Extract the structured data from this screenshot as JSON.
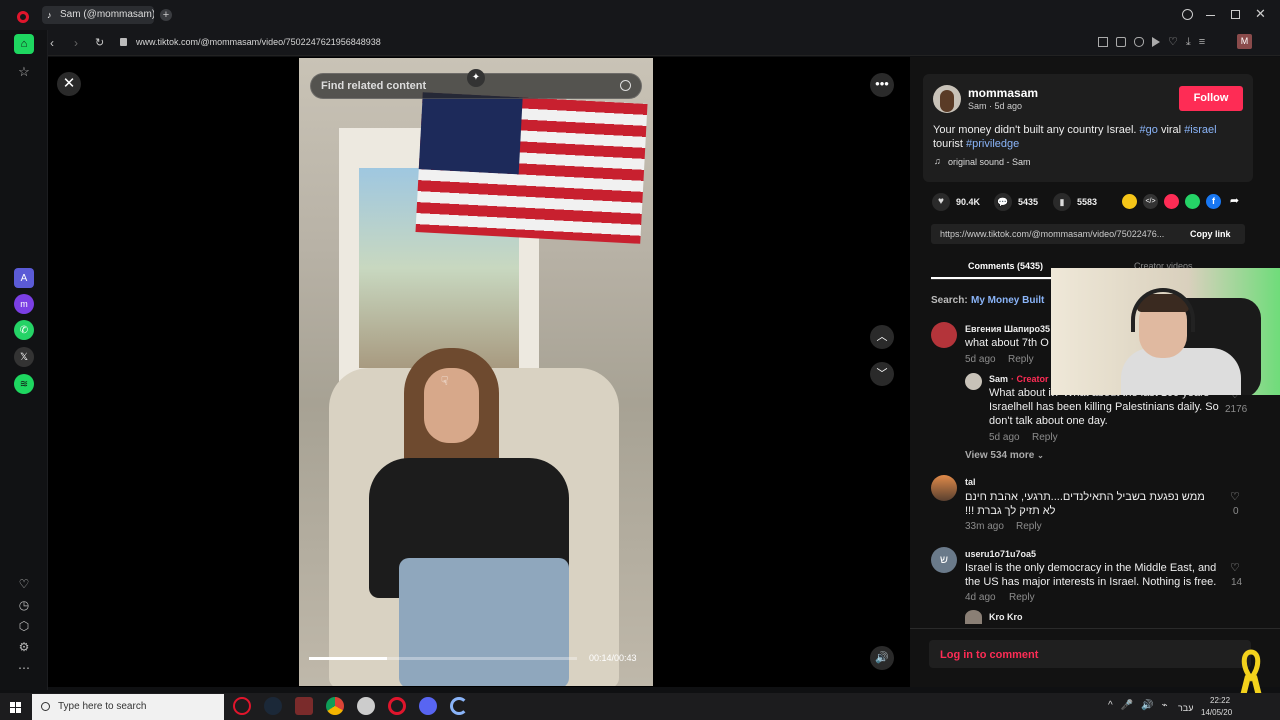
{
  "browser": {
    "tab_title": "Sam (@mommasam) |",
    "url": "www.tiktok.com/@mommasam/video/7502247621956848938",
    "profile_initial": "M"
  },
  "video": {
    "search_placeholder": "Find related content",
    "time": "00:14/00:43",
    "progress": 0.29
  },
  "author": {
    "username": "mommasam",
    "sub": "Sam · 5d ago",
    "follow_label": "Follow",
    "caption_text": "Your money didn't built any country Israel. ",
    "tags": [
      "#go",
      "viral",
      "#israel",
      "tourist",
      "#priviledge"
    ],
    "sound": "original sound - Sam"
  },
  "stats": {
    "likes": "90.4K",
    "comments": "5435",
    "saves": "5583"
  },
  "link": {
    "url": "https://www.tiktok.com/@mommasam/video/75022476...",
    "copy_label": "Copy link"
  },
  "tabs": {
    "comments": "Comments (5435)",
    "creator": "Creator videos"
  },
  "search": {
    "label": "Search:",
    "query": "My Money Built"
  },
  "comments": [
    {
      "name": "Евгения Шапиро35",
      "text": "what about 7th O",
      "date": "5d ago",
      "reply": "Reply"
    },
    {
      "name": "Sam",
      "badge": "· Creator",
      "text": "What about it? What about the last 100 years Israelhell has been killing Palestinians daily. So don't talk about one day.",
      "date": "5d ago",
      "reply": "Reply",
      "likes": "2176"
    },
    {
      "view_more": "View 534 more"
    },
    {
      "name": "tal",
      "text": "ממש נפגעת בשביל התאילנדים....תרגעי, אהבת חינם לא תזיק לך גברת !!!",
      "date": "33m ago",
      "reply": "Reply",
      "likes": "0"
    },
    {
      "name": "useru1o71u7oa5",
      "text": "Israel is the only democracy in the Middle East, and the US has major interests in Israel. Nothing is free.",
      "date": "4d ago",
      "reply": "Reply",
      "likes": "14",
      "avatar_letter": "ש"
    },
    {
      "name": "Kro Kro"
    }
  ],
  "login": "Log in to comment",
  "taskbar": {
    "search_placeholder": "Type here to search",
    "time": "22:22",
    "date": "14/05/20",
    "lang": "עבר"
  },
  "colors": {
    "accent": "#fe2c55",
    "tag": "#8ab4f8",
    "opera_green": "#1ed760"
  }
}
